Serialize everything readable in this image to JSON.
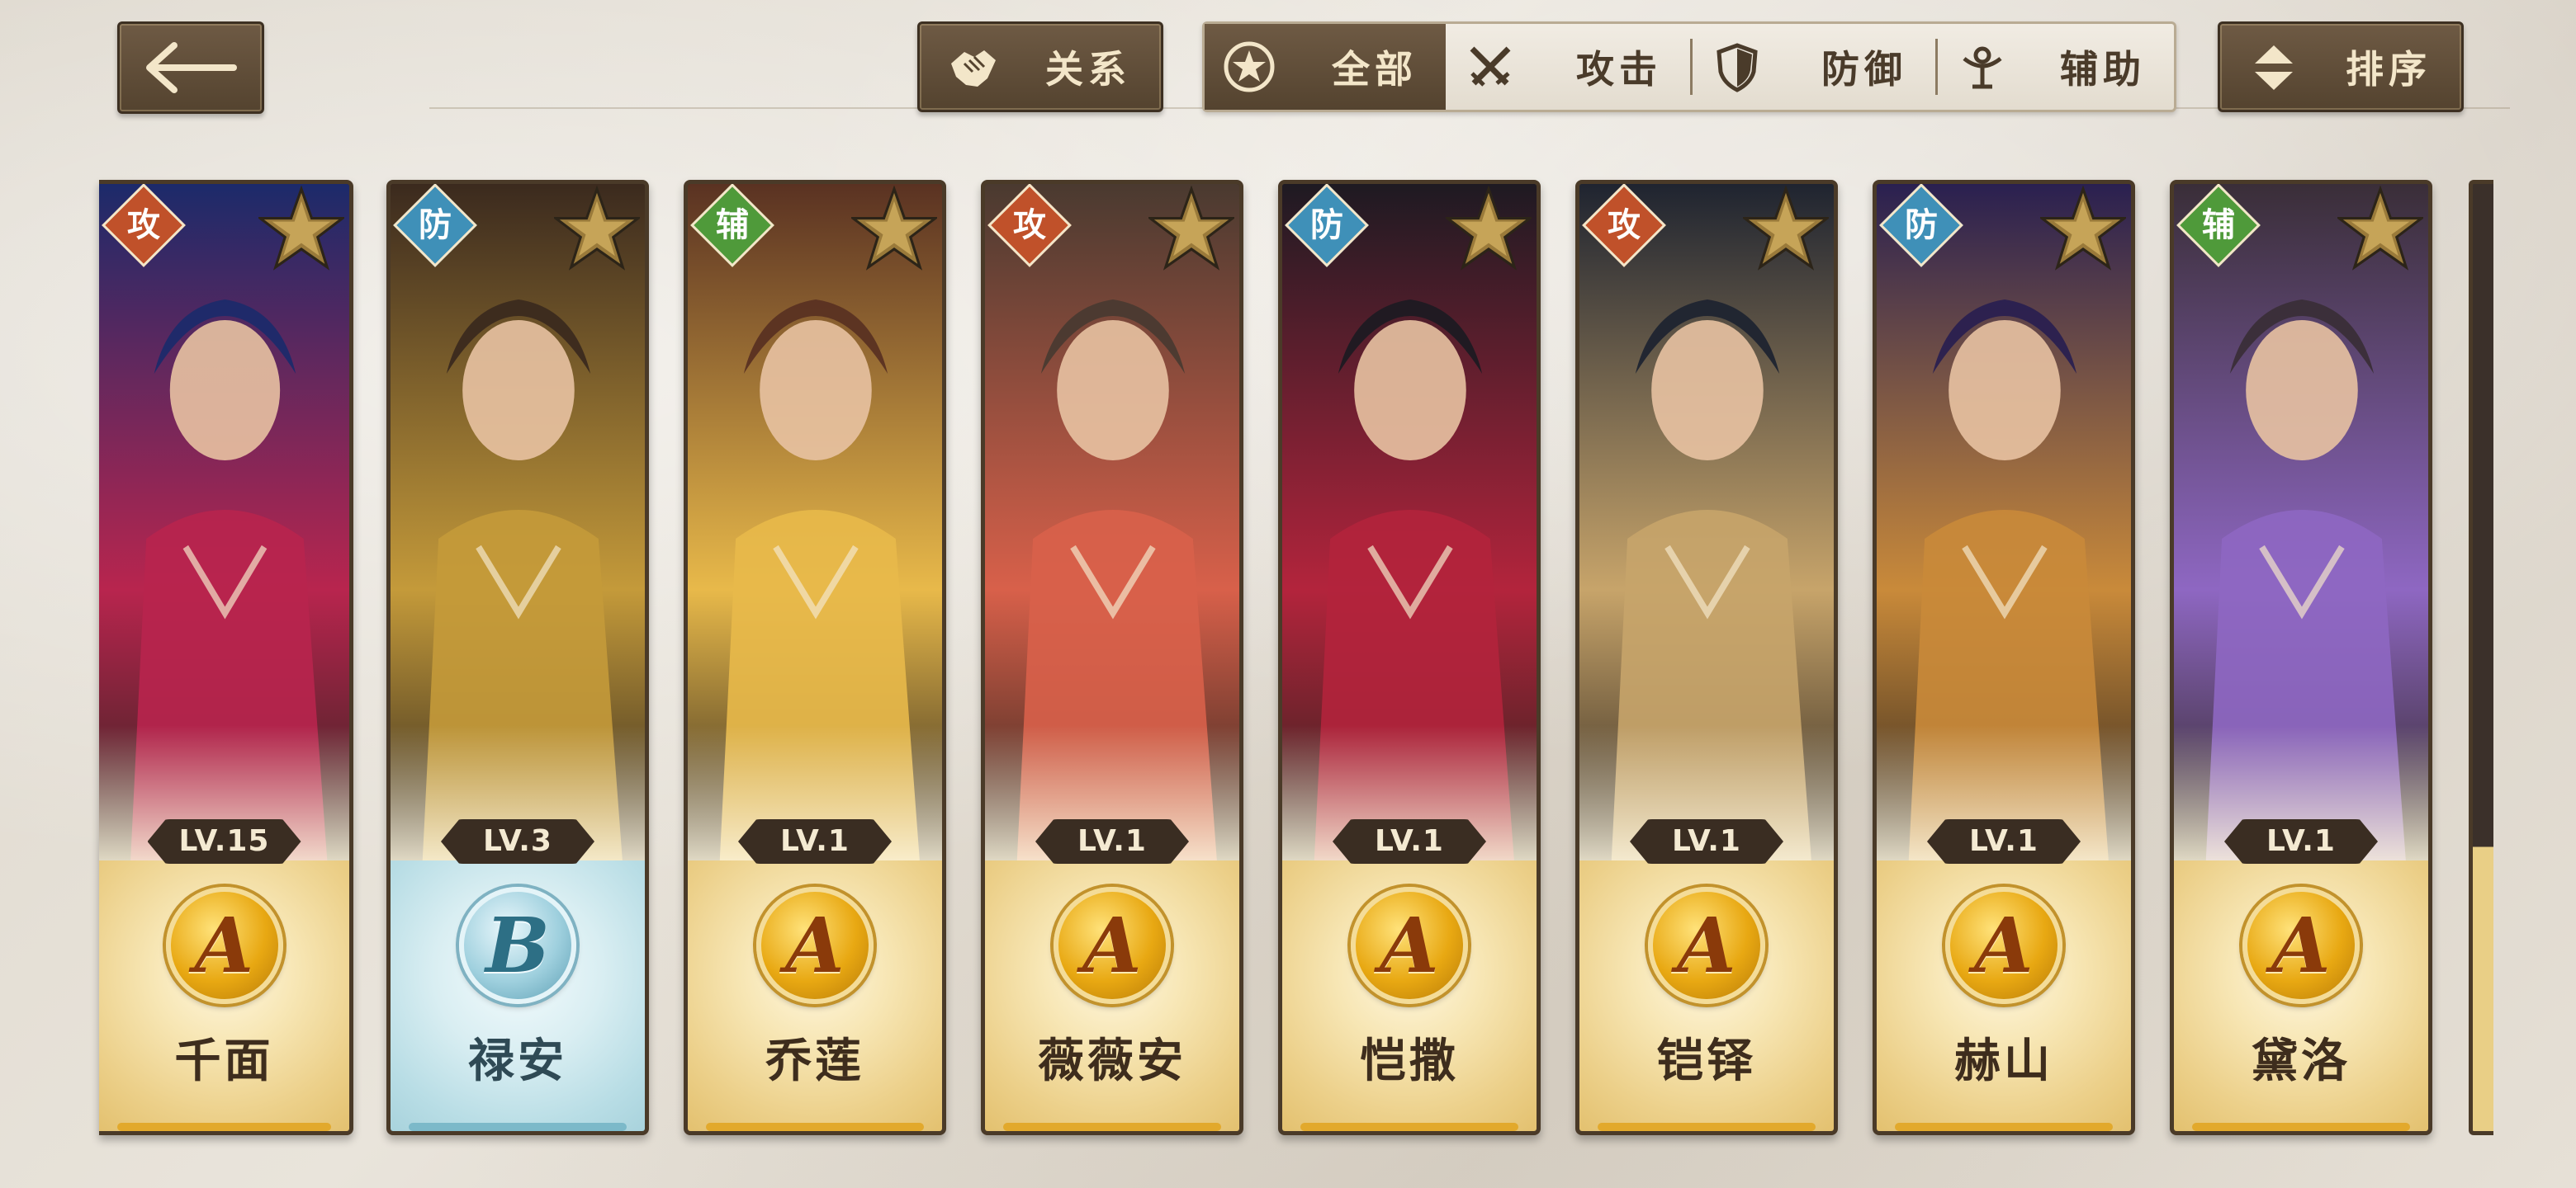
{
  "header": {
    "back_icon": "arrow-left-icon",
    "relation": {
      "label": "关系",
      "icon": "handshake-icon"
    },
    "filters": [
      {
        "label": "全部",
        "icon": "star-circle-icon",
        "active": true
      },
      {
        "label": "攻击",
        "icon": "crossed-swords-icon",
        "active": false
      },
      {
        "label": "防御",
        "icon": "shield-icon",
        "active": false
      },
      {
        "label": "辅助",
        "icon": "support-figure-icon",
        "active": false
      }
    ],
    "sort": {
      "label": "排序",
      "icon": "sort-updown-icon"
    }
  },
  "cards": [
    {
      "role": "攻",
      "level": "LV.15",
      "grade": "A",
      "name": "千面",
      "colors": [
        "#1c2a6a",
        "#b8254e"
      ]
    },
    {
      "role": "防",
      "level": "LV.3",
      "grade": "B",
      "name": "禄安",
      "colors": [
        "#3b2a1e",
        "#c49a3a"
      ]
    },
    {
      "role": "辅",
      "level": "LV.1",
      "grade": "A",
      "name": "乔莲",
      "colors": [
        "#5a3222",
        "#e8b94a"
      ]
    },
    {
      "role": "攻",
      "level": "LV.1",
      "grade": "A",
      "name": "薇薇安",
      "colors": [
        "#4a3a30",
        "#d8604a"
      ]
    },
    {
      "role": "防",
      "level": "LV.1",
      "grade": "A",
      "name": "恺撒",
      "colors": [
        "#1e1a22",
        "#b3243c"
      ]
    },
    {
      "role": "攻",
      "level": "LV.1",
      "grade": "A",
      "name": "铠铎",
      "colors": [
        "#1f2430",
        "#c7a46a"
      ]
    },
    {
      "role": "防",
      "level": "LV.1",
      "grade": "A",
      "name": "赫山",
      "colors": [
        "#2a2050",
        "#c98a3a"
      ]
    },
    {
      "role": "辅",
      "level": "LV.1",
      "grade": "A",
      "name": "黛洛",
      "colors": [
        "#3a2e38",
        "#8e67c2"
      ]
    }
  ]
}
